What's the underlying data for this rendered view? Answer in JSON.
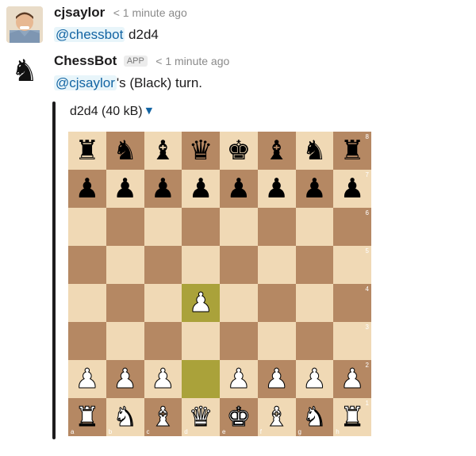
{
  "messages": [
    {
      "author": "cjsaylor",
      "time": "< 1 minute ago",
      "mention": "@chessbot",
      "text": " d2d4"
    },
    {
      "author": "ChessBot",
      "badge": "APP",
      "time": "< 1 minute ago",
      "mention": "@cjsaylor",
      "text": "'s (Black) turn."
    }
  ],
  "attachment": {
    "title": "d2d4 (40 kB)",
    "caret_icon": "caret-down-icon"
  },
  "board": {
    "light_color": "#f0d9b5",
    "dark_color": "#b58863",
    "highlight_light": "#cdd26a",
    "highlight_dark": "#aaa23a",
    "files": [
      "a",
      "b",
      "c",
      "d",
      "e",
      "f",
      "g",
      "h"
    ],
    "ranks": [
      "8",
      "7",
      "6",
      "5",
      "4",
      "3",
      "2",
      "1"
    ],
    "position": [
      [
        "bR",
        "bN",
        "bB",
        "bQ",
        "bK",
        "bB",
        "bN",
        "bR"
      ],
      [
        "bP",
        "bP",
        "bP",
        "bP",
        "bP",
        "bP",
        "bP",
        "bP"
      ],
      [
        "",
        "",
        "",
        "",
        "",
        "",
        "",
        ""
      ],
      [
        "",
        "",
        "",
        "",
        "",
        "",
        "",
        ""
      ],
      [
        "",
        "",
        "",
        "wP",
        "",
        "",
        "",
        ""
      ],
      [
        "",
        "",
        "",
        "",
        "",
        "",
        "",
        ""
      ],
      [
        "wP",
        "wP",
        "wP",
        "",
        "wP",
        "wP",
        "wP",
        "wP"
      ],
      [
        "wR",
        "wN",
        "wB",
        "wQ",
        "wK",
        "wB",
        "wN",
        "wR"
      ]
    ],
    "last_move": [
      "d2",
      "d4"
    ]
  }
}
